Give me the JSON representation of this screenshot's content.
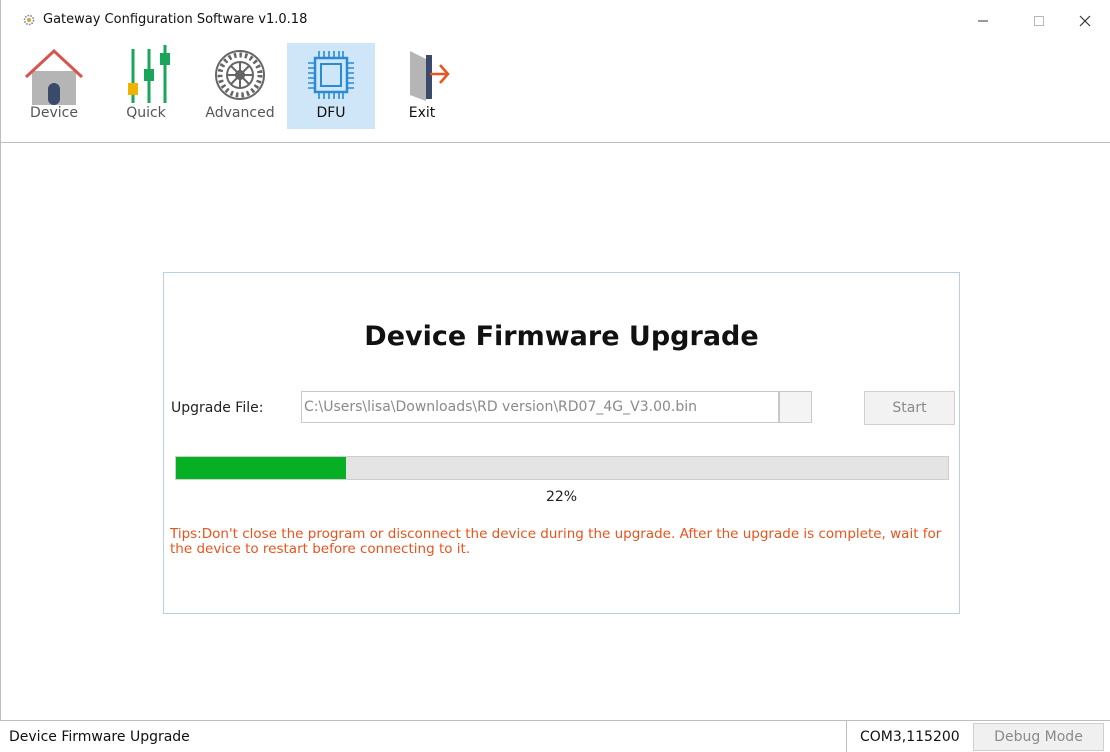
{
  "window": {
    "title": "Gateway Configuration Software v1.0.18",
    "app_icon": "gear-icon",
    "controls": {
      "minimize": "minimize-icon",
      "maximize": "maximize-icon",
      "close": "close-icon"
    }
  },
  "toolbar": {
    "items": [
      {
        "id": "device",
        "label": "Device",
        "icon": "house-icon",
        "active": false
      },
      {
        "id": "quick",
        "label": "Quick",
        "icon": "sliders-icon",
        "active": false
      },
      {
        "id": "advanced",
        "label": "Advanced",
        "icon": "gear-wheel-icon",
        "active": false
      },
      {
        "id": "dfu",
        "label": "DFU",
        "icon": "chip-icon",
        "active": true
      },
      {
        "id": "exit",
        "label": "Exit",
        "icon": "exit-door-icon",
        "active": false
      }
    ]
  },
  "dfu": {
    "title": "Device Firmware Upgrade",
    "file_label": "Upgrade File:",
    "file_path": "C:\\Users\\lisa\\Downloads\\RD version\\RD07_4G_V3.00.bin",
    "start_label": "Start",
    "progress_percent": 22,
    "progress_text": "22%",
    "tips": "Tips:Don't close the program or disconnect the device during the upgrade. After the upgrade is complete, wait for the device to restart before connecting to it."
  },
  "statusbar": {
    "left_text": "Device Firmware Upgrade",
    "port": "COM3,115200",
    "debug_label": "Debug Mode"
  },
  "colors": {
    "progress": "#06b025",
    "tips": "#e8541e",
    "active_tab": "#cfe6f8",
    "house_roof": "#d9534f",
    "slider_green": "#1aa55a",
    "slider_yellow": "#f0b400",
    "chip_blue": "#2a8ad4",
    "exit_orange": "#e8541e"
  }
}
